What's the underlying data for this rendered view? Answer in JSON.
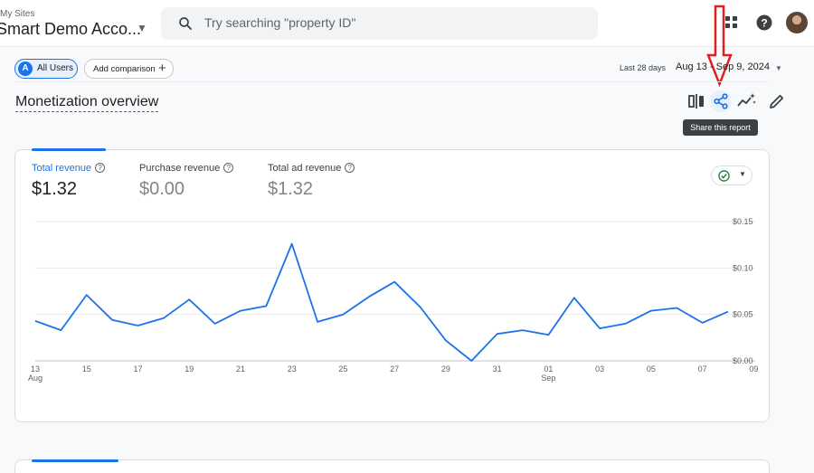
{
  "account": {
    "label": "My Sites",
    "name": "Smart Demo Acco..."
  },
  "search": {
    "placeholder": "Try searching \"property ID\""
  },
  "segments": {
    "all_users": "All Users",
    "badge": "A",
    "add_comparison": "Add comparison"
  },
  "date_range": {
    "label": "Last 28 days",
    "value": "Aug 13 - Sep 9, 2024"
  },
  "page": {
    "title": "Monetization overview"
  },
  "toolbar": {
    "share_tooltip": "Share this report"
  },
  "metrics": [
    {
      "label": "Total revenue",
      "value": "$1.32",
      "active": true
    },
    {
      "label": "Purchase revenue",
      "value": "$0.00",
      "active": false
    },
    {
      "label": "Total ad revenue",
      "value": "$1.32",
      "active": false
    }
  ],
  "colors": {
    "accent": "#1a73e8",
    "annotation": "#e02020",
    "status_ok": "#188038"
  },
  "icons": [
    "search-icon",
    "caret-down-icon",
    "apps-icon",
    "help-icon",
    "compare-icon",
    "share-icon",
    "insights-icon",
    "edit-icon",
    "check-circle-icon",
    "plus-icon"
  ],
  "chart_data": {
    "type": "line",
    "title": "",
    "xlabel": "",
    "ylabel": "",
    "y_tick_labels": [
      "$0.15",
      "$0.10",
      "$0.05",
      "$0.00"
    ],
    "y_ticks": [
      0.15,
      0.1,
      0.05,
      0.0
    ],
    "ylim": [
      0,
      0.15
    ],
    "y_axis_position": "right",
    "grid": true,
    "x_tick_labels": [
      {
        "day": "13",
        "month": "Aug"
      },
      {
        "day": "15",
        "month": ""
      },
      {
        "day": "17",
        "month": ""
      },
      {
        "day": "19",
        "month": ""
      },
      {
        "day": "21",
        "month": ""
      },
      {
        "day": "23",
        "month": ""
      },
      {
        "day": "25",
        "month": ""
      },
      {
        "day": "27",
        "month": ""
      },
      {
        "day": "29",
        "month": ""
      },
      {
        "day": "31",
        "month": ""
      },
      {
        "day": "01",
        "month": "Sep"
      },
      {
        "day": "03",
        "month": ""
      },
      {
        "day": "05",
        "month": ""
      },
      {
        "day": "07",
        "month": ""
      },
      {
        "day": "09",
        "month": ""
      }
    ],
    "x": [
      "2024-08-13",
      "2024-08-14",
      "2024-08-15",
      "2024-08-16",
      "2024-08-17",
      "2024-08-18",
      "2024-08-19",
      "2024-08-20",
      "2024-08-21",
      "2024-08-22",
      "2024-08-23",
      "2024-08-24",
      "2024-08-25",
      "2024-08-26",
      "2024-08-27",
      "2024-08-28",
      "2024-08-29",
      "2024-08-30",
      "2024-08-31",
      "2024-09-01",
      "2024-09-02",
      "2024-09-03",
      "2024-09-04",
      "2024-09-05",
      "2024-09-06",
      "2024-09-07",
      "2024-09-08",
      "2024-09-09"
    ],
    "series": [
      {
        "values": [
          0.043,
          0.033,
          0.071,
          0.044,
          0.038,
          0.046,
          0.066,
          0.04,
          0.054,
          0.059,
          0.126,
          0.042,
          0.05,
          0.069,
          0.085,
          0.058,
          0.022,
          0.0,
          0.029,
          0.033,
          0.028,
          0.068,
          0.035,
          0.04,
          0.054,
          0.057,
          0.041,
          0.053
        ]
      }
    ]
  }
}
